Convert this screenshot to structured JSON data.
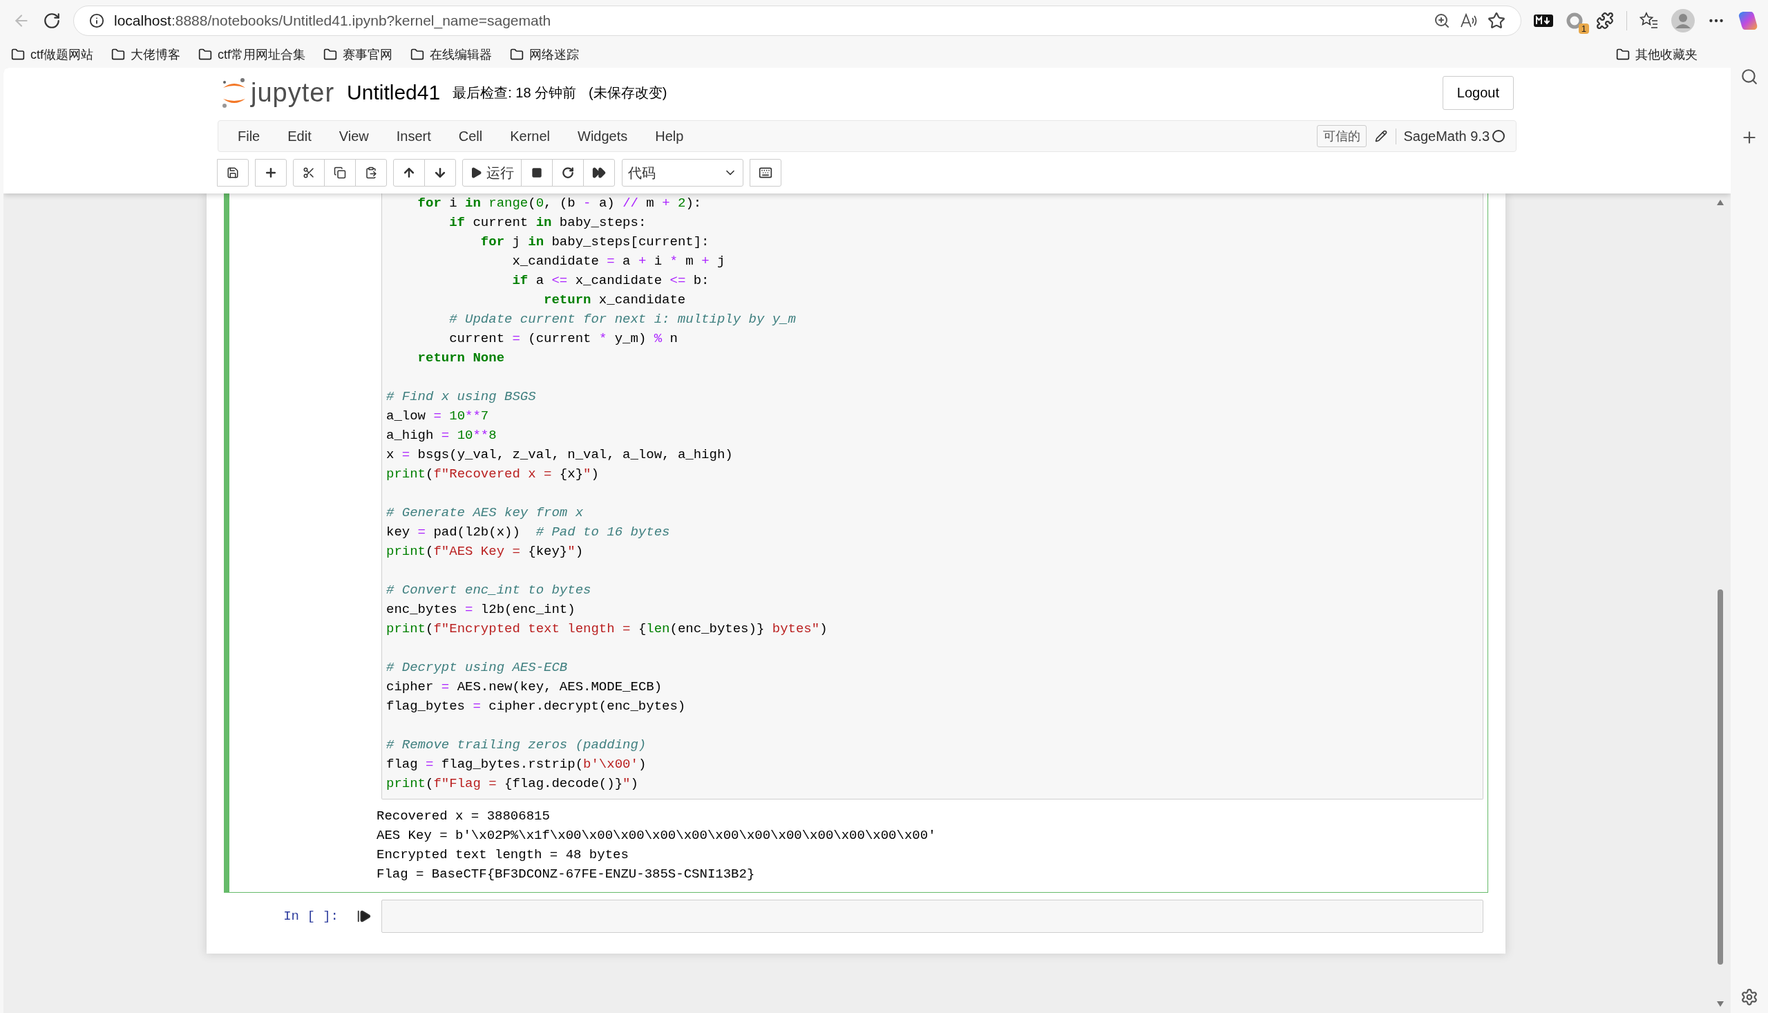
{
  "browser": {
    "url": {
      "host": "localhost",
      "path": ":8888/notebooks/Untitled41.ipynb?kernel_name=sagemath"
    },
    "extension_badge": "1",
    "bookmarks": [
      "ctf做题网站",
      "大佬博客",
      "ctf常用网址合集",
      "赛事官网",
      "在线编辑器",
      "网络迷踪"
    ],
    "other_bookmarks": "其他收藏夹"
  },
  "header": {
    "logo_text": "jupyter",
    "notebook_name": "Untitled41",
    "checkpoint": "最后检查: 18 分钟前",
    "unsaved": "(未保存改变)",
    "logout": "Logout"
  },
  "menu": [
    "File",
    "Edit",
    "View",
    "Insert",
    "Cell",
    "Kernel",
    "Widgets",
    "Help"
  ],
  "trusted": "可信的",
  "kernel": {
    "name": "SageMath 9.3",
    "busy": false
  },
  "toolbar": {
    "run_label": "运行",
    "cell_type": "代码"
  },
  "cell": {
    "selected": true,
    "blocks": [
      [
        [
          {
            "text": "    for",
            "kind": "kw"
          },
          {
            "text": " i ",
            "kind": "tx"
          },
          {
            "text": "in",
            "kind": "kw"
          },
          {
            "text": " range",
            "kind": "bi"
          },
          {
            "text": "(",
            "kind": "tx"
          },
          {
            "text": "0",
            "kind": "num"
          },
          {
            "text": ", (b ",
            "kind": "tx"
          },
          {
            "text": "-",
            "kind": "op"
          },
          {
            "text": " a) ",
            "kind": "tx"
          },
          {
            "text": "//",
            "kind": "op"
          },
          {
            "text": " m ",
            "kind": "tx"
          },
          {
            "text": "+",
            "kind": "op"
          },
          {
            "text": " 2",
            "kind": "num"
          },
          {
            "text": "):",
            "kind": "tx"
          }
        ],
        [
          {
            "text": "        if",
            "kind": "kw"
          },
          {
            "text": " current ",
            "kind": "tx"
          },
          {
            "text": "in",
            "kind": "kw"
          },
          {
            "text": " baby_steps:",
            "kind": "tx"
          }
        ],
        [
          {
            "text": "            for",
            "kind": "kw"
          },
          {
            "text": " j ",
            "kind": "tx"
          },
          {
            "text": "in",
            "kind": "kw"
          },
          {
            "text": " baby_steps[current]:",
            "kind": "tx"
          }
        ],
        [
          {
            "text": "                x_candidate ",
            "kind": "tx"
          },
          {
            "text": "=",
            "kind": "op"
          },
          {
            "text": " a ",
            "kind": "tx"
          },
          {
            "text": "+",
            "kind": "op"
          },
          {
            "text": " i ",
            "kind": "tx"
          },
          {
            "text": "*",
            "kind": "op"
          },
          {
            "text": " m ",
            "kind": "tx"
          },
          {
            "text": "+",
            "kind": "op"
          },
          {
            "text": " j",
            "kind": "tx"
          }
        ],
        [
          {
            "text": "                if",
            "kind": "kw"
          },
          {
            "text": " a ",
            "kind": "tx"
          },
          {
            "text": "<=",
            "kind": "op"
          },
          {
            "text": " x_candidate ",
            "kind": "tx"
          },
          {
            "text": "<=",
            "kind": "op"
          },
          {
            "text": " b:",
            "kind": "tx"
          }
        ],
        [
          {
            "text": "                    return",
            "kind": "kw"
          },
          {
            "text": " x_candidate",
            "kind": "tx"
          }
        ],
        [
          {
            "text": "        # Update current for next i: multiply by y_m",
            "kind": "cm"
          }
        ],
        [
          {
            "text": "        current ",
            "kind": "tx"
          },
          {
            "text": "=",
            "kind": "op"
          },
          {
            "text": " (current ",
            "kind": "tx"
          },
          {
            "text": "*",
            "kind": "op"
          },
          {
            "text": " y_m) ",
            "kind": "tx"
          },
          {
            "text": "%",
            "kind": "op"
          },
          {
            "text": " n",
            "kind": "tx"
          }
        ],
        [
          {
            "text": "    return None",
            "kind": "kw"
          }
        ]
      ],
      [
        [
          {
            "text": "# Find x using BSGS",
            "kind": "cm"
          }
        ],
        [
          {
            "text": "a_low ",
            "kind": "tx"
          },
          {
            "text": "=",
            "kind": "op"
          },
          {
            "text": " 10",
            "kind": "num"
          },
          {
            "text": "**",
            "kind": "op"
          },
          {
            "text": "7",
            "kind": "num"
          }
        ],
        [
          {
            "text": "a_high ",
            "kind": "tx"
          },
          {
            "text": "=",
            "kind": "op"
          },
          {
            "text": " 10",
            "kind": "num"
          },
          {
            "text": "**",
            "kind": "op"
          },
          {
            "text": "8",
            "kind": "num"
          }
        ],
        [
          {
            "text": "x ",
            "kind": "tx"
          },
          {
            "text": "=",
            "kind": "op"
          },
          {
            "text": " bsgs(y_val, z_val, n_val, a_low, a_high)",
            "kind": "tx"
          }
        ],
        [
          {
            "text": "print",
            "kind": "bi"
          },
          {
            "text": "(",
            "kind": "tx"
          },
          {
            "text": "f\"Recovered x = ",
            "kind": "str"
          },
          {
            "text": "{x}",
            "kind": "tx"
          },
          {
            "text": "\"",
            "kind": "str"
          },
          {
            "text": ")",
            "kind": "tx"
          }
        ]
      ],
      [
        [
          {
            "text": "# Generate AES key from x",
            "kind": "cm"
          }
        ],
        [
          {
            "text": "key ",
            "kind": "tx"
          },
          {
            "text": "=",
            "kind": "op"
          },
          {
            "text": " pad(l2b(x))",
            "kind": "tx"
          },
          {
            "text": "  # Pad to 16 bytes",
            "kind": "cm"
          }
        ],
        [
          {
            "text": "print",
            "kind": "bi"
          },
          {
            "text": "(",
            "kind": "tx"
          },
          {
            "text": "f\"AES Key = ",
            "kind": "str"
          },
          {
            "text": "{key}",
            "kind": "tx"
          },
          {
            "text": "\"",
            "kind": "str"
          },
          {
            "text": ")",
            "kind": "tx"
          }
        ]
      ],
      [
        [
          {
            "text": "# Convert enc_int to bytes",
            "kind": "cm"
          }
        ],
        [
          {
            "text": "enc_bytes ",
            "kind": "tx"
          },
          {
            "text": "=",
            "kind": "op"
          },
          {
            "text": " l2b(enc_int)",
            "kind": "tx"
          }
        ],
        [
          {
            "text": "print",
            "kind": "bi"
          },
          {
            "text": "(",
            "kind": "tx"
          },
          {
            "text": "f\"Encrypted text length = ",
            "kind": "str"
          },
          {
            "text": "{",
            "kind": "tx"
          },
          {
            "text": "len",
            "kind": "bi"
          },
          {
            "text": "(enc_bytes)}",
            "kind": "tx"
          },
          {
            "text": " bytes\"",
            "kind": "str"
          },
          {
            "text": ")",
            "kind": "tx"
          }
        ]
      ],
      [
        [
          {
            "text": "# Decrypt using AES-ECB",
            "kind": "cm"
          }
        ],
        [
          {
            "text": "cipher ",
            "kind": "tx"
          },
          {
            "text": "=",
            "kind": "op"
          },
          {
            "text": " AES.new(key, AES.MODE_ECB)",
            "kind": "tx"
          }
        ],
        [
          {
            "text": "flag_bytes ",
            "kind": "tx"
          },
          {
            "text": "=",
            "kind": "op"
          },
          {
            "text": " cipher.decrypt(enc_bytes)",
            "kind": "tx"
          }
        ]
      ],
      [
        [
          {
            "text": "# Remove trailing zeros (padding)",
            "kind": "cm"
          }
        ],
        [
          {
            "text": "flag ",
            "kind": "tx"
          },
          {
            "text": "=",
            "kind": "op"
          },
          {
            "text": " flag_bytes.rstrip(",
            "kind": "tx"
          },
          {
            "text": "b'\\x00'",
            "kind": "str"
          },
          {
            "text": ")",
            "kind": "tx"
          }
        ],
        [
          {
            "text": "print",
            "kind": "bi"
          },
          {
            "text": "(",
            "kind": "tx"
          },
          {
            "text": "f\"Flag = ",
            "kind": "str"
          },
          {
            "text": "{flag.decode()}",
            "kind": "tx"
          },
          {
            "text": "\"",
            "kind": "str"
          },
          {
            "text": ")",
            "kind": "tx"
          }
        ]
      ]
    ],
    "output": [
      "Recovered x = 38806815",
      "AES Key = b'\\x02P%\\x1f\\x00\\x00\\x00\\x00\\x00\\x00\\x00\\x00\\x00\\x00\\x00\\x00'",
      "Encrypted text length = 48 bytes",
      "Flag = BaseCTF{BF3DCONZ-67FE-ENZU-385S-CSNI13B2}"
    ]
  },
  "empty_cell": {
    "prompt": "In [ ]:",
    "selected": false
  }
}
